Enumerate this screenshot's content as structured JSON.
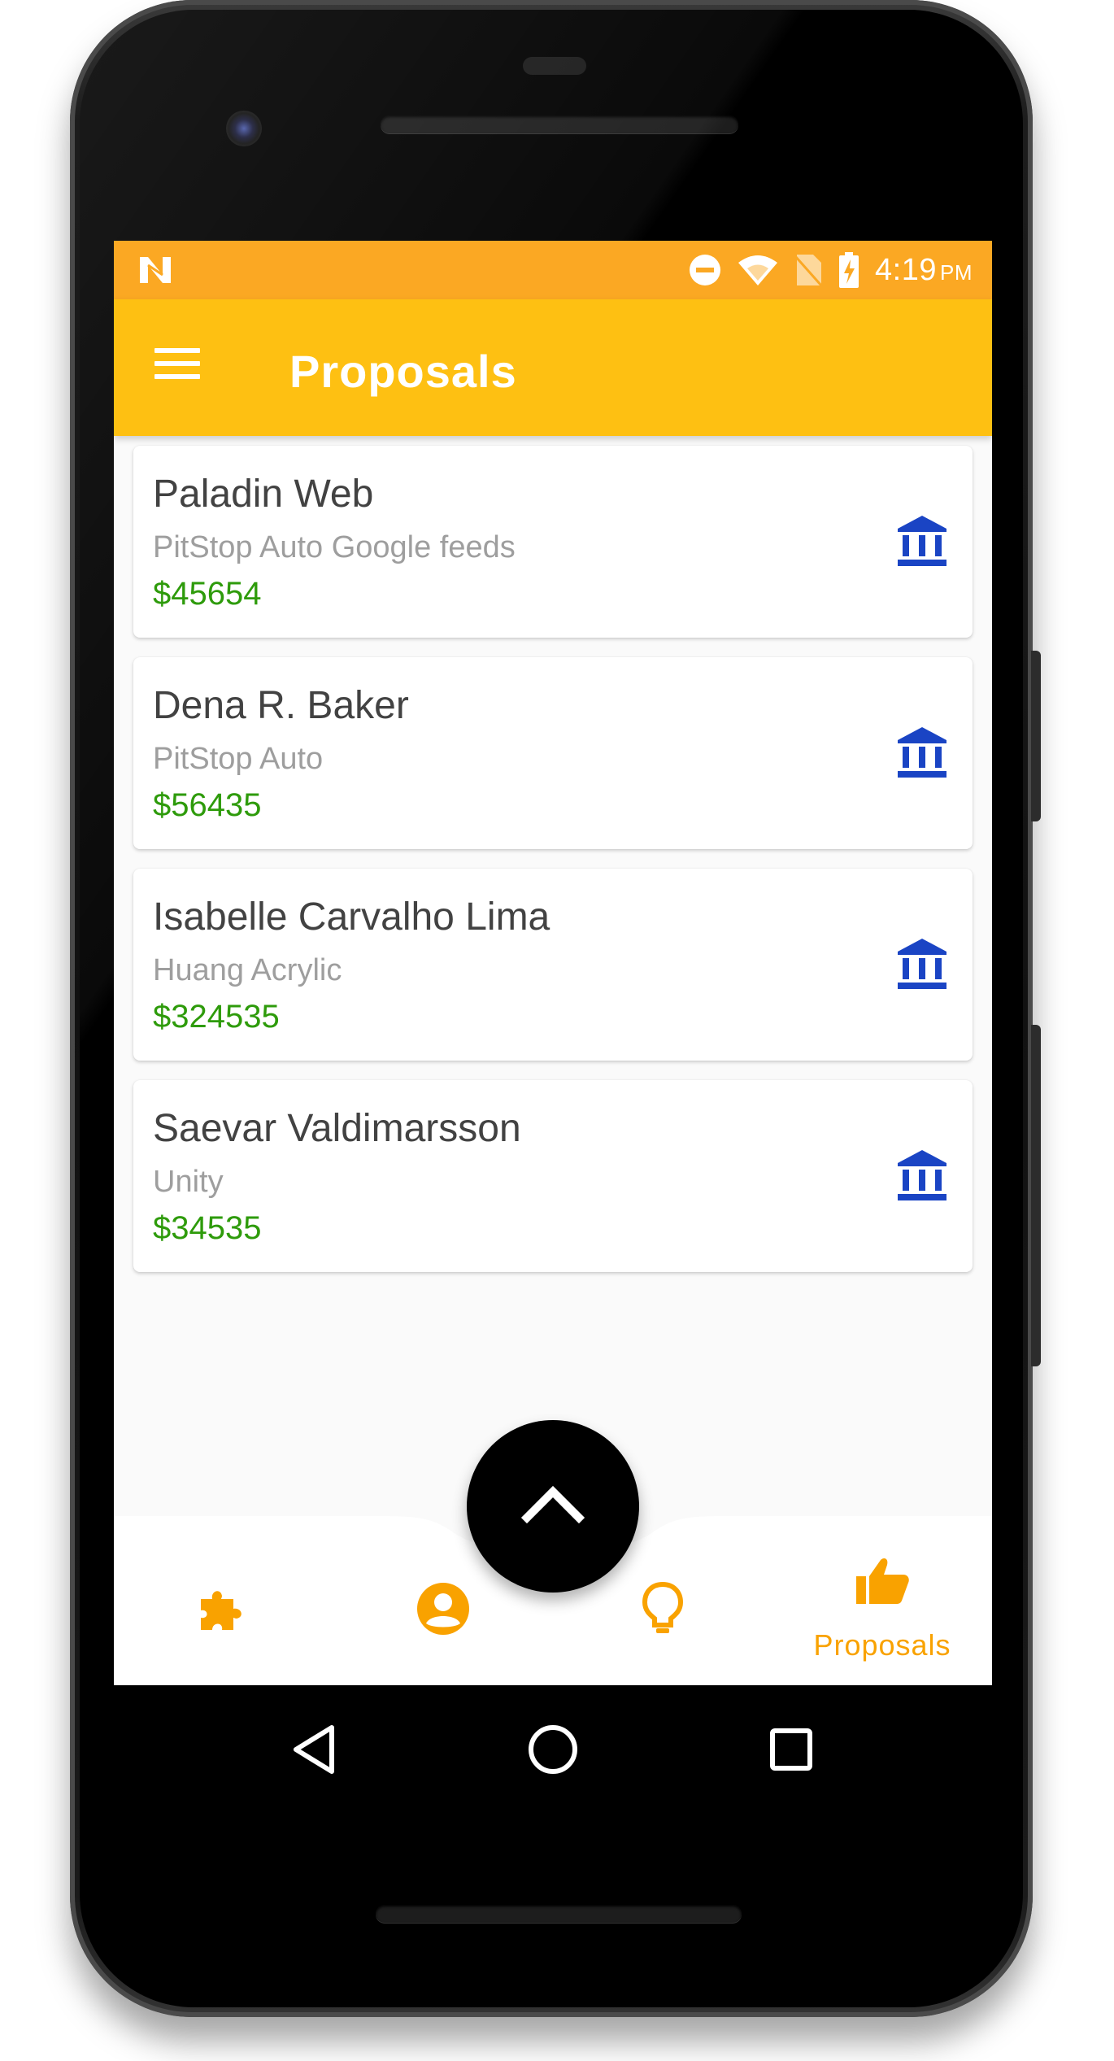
{
  "status_bar": {
    "time": "4:19",
    "ampm": "PM",
    "icons": [
      "notification-n-icon",
      "do-not-disturb-icon",
      "wifi-icon",
      "no-sim-icon",
      "battery-charging-icon"
    ]
  },
  "app_bar": {
    "title": "Proposals",
    "menu_icon": "hamburger-menu-icon"
  },
  "proposals": [
    {
      "name": "Paladin Web",
      "company": "PitStop Auto Google feeds",
      "amount": "$45654",
      "icon": "bank-icon"
    },
    {
      "name": "Dena R. Baker",
      "company": "PitStop Auto",
      "amount": "$56435",
      "icon": "bank-icon"
    },
    {
      "name": "Isabelle Carvalho Lima",
      "company": "Huang Acrylic",
      "amount": "$324535",
      "icon": "bank-icon"
    },
    {
      "name": "Saevar Valdimarsson",
      "company": "Unity",
      "amount": "$34535",
      "icon": "bank-icon"
    }
  ],
  "bottom_nav": {
    "items": [
      {
        "icon": "puzzle-icon",
        "label": ""
      },
      {
        "icon": "account-circle-icon",
        "label": ""
      },
      {
        "icon": "lightbulb-icon",
        "label": ""
      },
      {
        "icon": "thumb-up-icon",
        "label": "Proposals",
        "active": true
      }
    ],
    "fab_icon": "chevron-up-icon"
  },
  "system_nav": [
    "back-icon",
    "home-icon",
    "recents-icon"
  ],
  "colors": {
    "status_bar": "#fba823",
    "app_bar": "#fec012",
    "accent": "#f9a200",
    "amount": "#2e9b0b",
    "bank_icon": "#1a44c4"
  }
}
